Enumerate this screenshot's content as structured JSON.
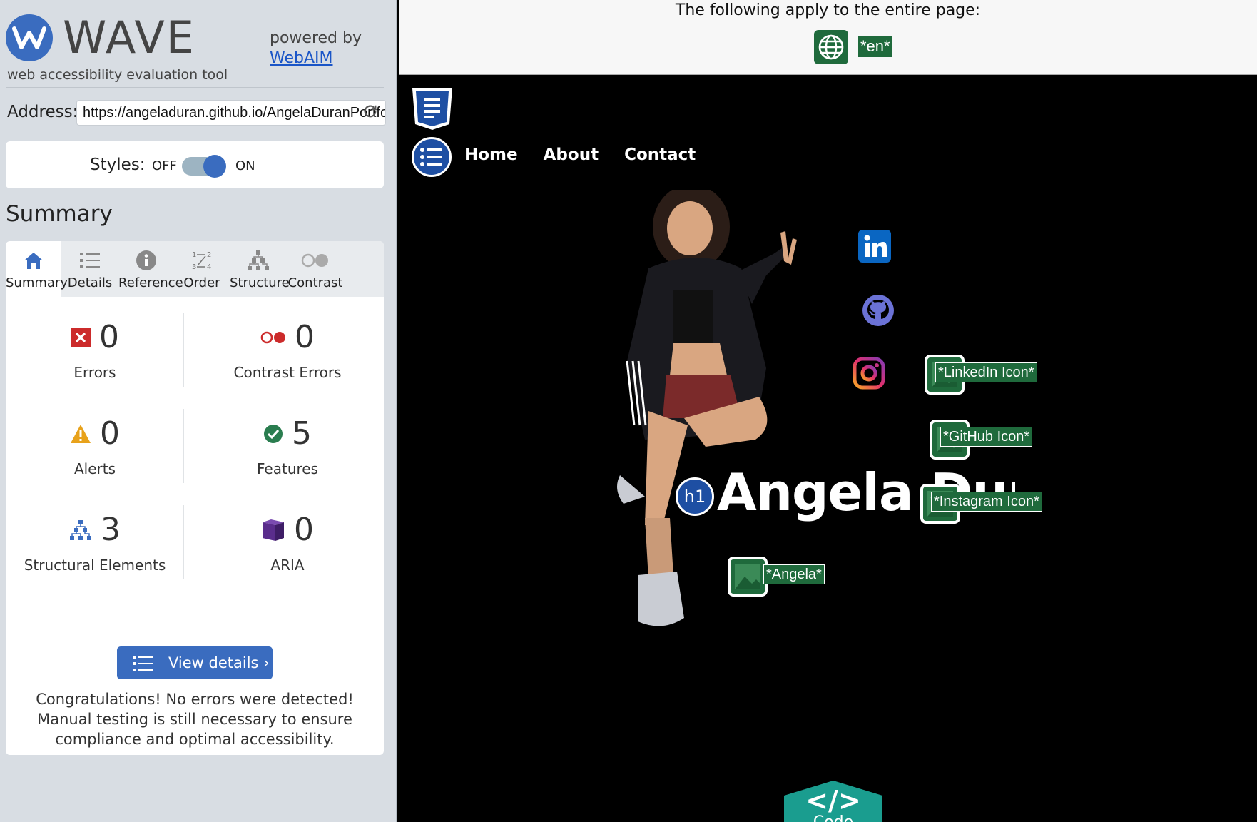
{
  "wave": {
    "logo_text": "WAVE",
    "tagline": "web accessibility evaluation tool",
    "powered_by": "powered by",
    "webaim_link": "WebAIM",
    "address_label": "Address:",
    "address_value": "https://angeladuran.github.io/AngelaDuranPortfolio/",
    "styles_label": "Styles:",
    "styles_off": "OFF",
    "styles_on": "ON",
    "styles_state": "on",
    "summary_heading": "Summary",
    "tabs": [
      {
        "label": "Summary",
        "icon": "home-icon",
        "active": true
      },
      {
        "label": "Details",
        "icon": "list-icon",
        "active": false
      },
      {
        "label": "Reference",
        "icon": "info-icon",
        "active": false
      },
      {
        "label": "Order",
        "icon": "order-icon",
        "active": false
      },
      {
        "label": "Structure",
        "icon": "structure-icon",
        "active": false
      },
      {
        "label": "Contrast",
        "icon": "contrast-icon",
        "active": false
      }
    ],
    "stats": {
      "errors": {
        "count": "0",
        "label": "Errors"
      },
      "contrast_errors": {
        "count": "0",
        "label": "Contrast Errors"
      },
      "alerts": {
        "count": "0",
        "label": "Alerts"
      },
      "features": {
        "count": "5",
        "label": "Features"
      },
      "structural": {
        "count": "3",
        "label": "Structural Elements"
      },
      "aria": {
        "count": "0",
        "label": "ARIA"
      }
    },
    "view_details": "View details ›",
    "congrats": "Congratulations! No errors were detected! Manual testing is still necessary to ensure compliance and optimal accessibility."
  },
  "page": {
    "apply_text": "The following apply to the entire page:",
    "lang_tag": "*en*",
    "nav": [
      "Home",
      "About",
      "Contact"
    ],
    "hero_name": "Angela Duran",
    "alt_tags": {
      "linkedin": "*LinkedIn Icon*",
      "github": "*GitHub Icon*",
      "instagram": "*Instagram Icon*",
      "photo": "*Angela*"
    },
    "code_symbol": "</>",
    "code_label": "Code"
  },
  "colors": {
    "wave_blue": "#3a6cbf",
    "feature_green": "#1f6a3c",
    "error_red": "#cc2b2b",
    "alert_orange": "#e8a21b",
    "aria_purple": "#5a2d8c",
    "code_teal": "#1a9d8f"
  }
}
